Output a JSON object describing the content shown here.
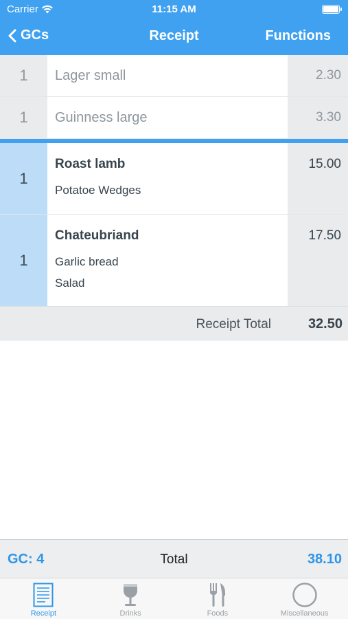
{
  "status": {
    "carrier": "Carrier",
    "time": "11:15 AM"
  },
  "nav": {
    "back_label": "GCs",
    "title": "Receipt",
    "functions_label": "Functions"
  },
  "drinks": [
    {
      "qty": "1",
      "name": "Lager small",
      "price": "2.30"
    },
    {
      "qty": "1",
      "name": "Guinness large",
      "price": "3.30"
    }
  ],
  "foods": [
    {
      "qty": "1",
      "name": "Roast lamb",
      "price": "15.00",
      "addons": [
        "Potatoe Wedges"
      ]
    },
    {
      "qty": "1",
      "name": "Chateubriand",
      "price": "17.50",
      "addons": [
        "Garlic bread",
        "Salad"
      ]
    }
  ],
  "receipt_total": {
    "label": "Receipt Total",
    "value": "32.50"
  },
  "footer": {
    "gc_label": "GC:  4",
    "total_label": "Total",
    "total_value": "38.10"
  },
  "tabs": [
    {
      "label": "Receipt",
      "icon": "receipt-icon",
      "active": true
    },
    {
      "label": "Drinks",
      "icon": "wine-glass-icon",
      "active": false
    },
    {
      "label": "Foods",
      "icon": "fork-knife-icon",
      "active": false
    },
    {
      "label": "Miscellaneous",
      "icon": "circle-icon",
      "active": false
    }
  ],
  "colors": {
    "accent": "#3fa1f0",
    "link": "#2f95e8",
    "food_qty_bg": "#bcdcf8",
    "grey_cell": "#e9ebed"
  }
}
